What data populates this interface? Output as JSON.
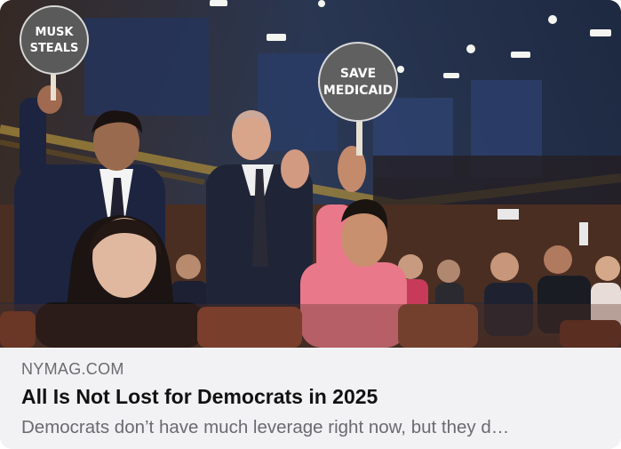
{
  "link_preview": {
    "domain": "NYMAG.COM",
    "title": "All Is Not Lost for Democrats in 2025",
    "description": "Democrats don’t have much leverage right now, but they d…"
  },
  "photo": {
    "sign_left": {
      "line1": "MUSK",
      "line2": "STEALS"
    },
    "sign_right": {
      "line1": "SAVE",
      "line2": "MEDICAID"
    }
  }
}
